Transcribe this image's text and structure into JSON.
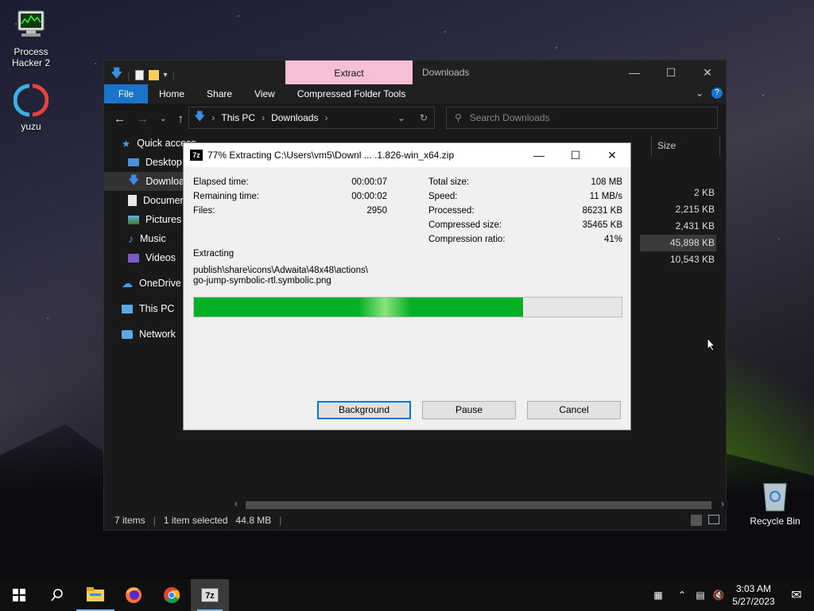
{
  "desktop": {
    "icons": [
      {
        "label": "Process Hacker 2"
      },
      {
        "label": "yuzu"
      },
      {
        "label": "Recycle Bin"
      }
    ]
  },
  "explorer": {
    "context_tab": "Extract",
    "title": "Downloads",
    "ribbon_tabs": [
      "File",
      "Home",
      "Share",
      "View",
      "Compressed Folder Tools"
    ],
    "breadcrumb": [
      "This PC",
      "Downloads"
    ],
    "search_placeholder": "Search Downloads",
    "sidebar": [
      {
        "label": "Quick access",
        "icon": "star-icon"
      },
      {
        "label": "Desktop",
        "icon": "desktop-folder-icon"
      },
      {
        "label": "Downloads",
        "icon": "download-arrow-icon",
        "selected": true
      },
      {
        "label": "Documents",
        "icon": "document-icon"
      },
      {
        "label": "Pictures",
        "icon": "pictures-icon"
      },
      {
        "label": "Music",
        "icon": "music-icon"
      },
      {
        "label": "Videos",
        "icon": "video-icon"
      },
      {
        "label": "OneDrive",
        "icon": "cloud-icon"
      },
      {
        "label": "This PC",
        "icon": "computer-icon"
      },
      {
        "label": "Network",
        "icon": "network-icon"
      }
    ],
    "column_size": "Size",
    "file_sizes": [
      "2 KB",
      "2,215 KB",
      "2,431 KB",
      "45,898 KB",
      "10,543 KB"
    ],
    "selected_index": 3,
    "status": {
      "items": "7 items",
      "selected": "1 item selected",
      "selected_size": "44.8 MB"
    }
  },
  "dialog": {
    "title": "77% Extracting C:\\Users\\vm5\\Downl ... .1.826-win_x64.zip",
    "left": [
      {
        "label": "Elapsed time:",
        "value": "00:00:07"
      },
      {
        "label": "Remaining time:",
        "value": "00:00:02"
      },
      {
        "label": "Files:",
        "value": "2950"
      }
    ],
    "right": [
      {
        "label": "Total size:",
        "value": "108 MB"
      },
      {
        "label": "Speed:",
        "value": "11 MB/s"
      },
      {
        "label": "Processed:",
        "value": "86231 KB"
      },
      {
        "label": "Compressed size:",
        "value": "35465 KB"
      },
      {
        "label": "Compression ratio:",
        "value": "41%"
      }
    ],
    "operation": "Extracting",
    "current_path_line1": "publish\\share\\icons\\Adwaita\\48x48\\actions\\",
    "current_path_line2": "go-jump-symbolic-rtl.symbolic.png",
    "progress": 0.77,
    "buttons": {
      "background": "Background",
      "pause": "Pause",
      "cancel": "Cancel"
    }
  },
  "taskbar": {
    "apps": [
      "start-icon",
      "search-icon",
      "file-explorer-icon",
      "firefox-icon",
      "chrome-icon",
      "7zip-icon"
    ],
    "time": "3:03 AM",
    "date": "5/27/2023"
  }
}
